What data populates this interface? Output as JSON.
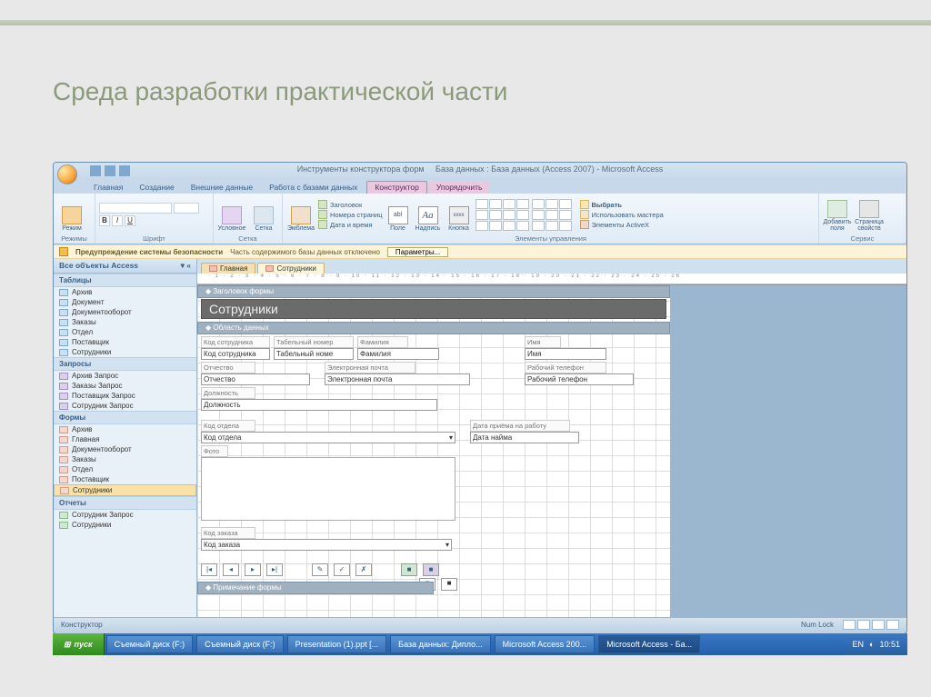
{
  "slide": {
    "title": "Среда разработки практической части"
  },
  "window": {
    "title_left": "Инструменты конструктора форм",
    "title_right": "База данных : База данных (Access 2007) - Microsoft Access"
  },
  "ribbon_tabs": [
    "Главная",
    "Создание",
    "Внешние данные",
    "Работа с базами данных",
    "Конструктор",
    "Упорядочить"
  ],
  "ribbon": {
    "g1": {
      "label": "Режимы",
      "btn": "Режим"
    },
    "g2": {
      "label": "Шрифт"
    },
    "g3": {
      "label": "Сетка",
      "btn1": "Условное",
      "btn2": "Сетка"
    },
    "g4": {
      "label": "Элементы управления",
      "btn_emblem": "Эмблема",
      "lines": [
        "Заголовок",
        "Номера страниц",
        "Дата и время"
      ],
      "btn_pole": "Поле",
      "btn_nadpis": "Надпись",
      "btn_knopka": "Кнопка",
      "side": [
        "Выбрать",
        "Использовать мастера",
        "Элементы ActiveX"
      ]
    },
    "g5": {
      "label": "Сервис",
      "btn_add": "Добавить поля",
      "btn_prop": "Страница свойств"
    }
  },
  "security": {
    "warn": "Предупреждение системы безопасности",
    "msg": "Часть содержимого базы данных отключено",
    "btn": "Параметры..."
  },
  "nav": {
    "header": "Все объекты Access",
    "sec": [
      "Таблицы",
      "Запросы",
      "Формы",
      "Отчеты"
    ],
    "tables": [
      "Архив",
      "Документ",
      "Документооборот",
      "Заказы",
      "Отдел",
      "Поставщик",
      "Сотрудники"
    ],
    "queries": [
      "Архив Запрос",
      "Заказы Запрос",
      "Поставщик Запрос",
      "Сотрудник Запрос"
    ],
    "forms": [
      "Архив",
      "Главная",
      "Документооборот",
      "Заказы",
      "Отдел",
      "Поставщик",
      "Сотрудники"
    ],
    "reports": [
      "Сотрудник Запрос",
      "Сотрудники"
    ]
  },
  "doc_tabs": [
    "Главная",
    "Сотрудники"
  ],
  "form": {
    "sec_header": "Заголовок формы",
    "title": "Сотрудники",
    "sec_data": "Область данных",
    "sec_footer": "Примечание формы",
    "labels": {
      "l1": "Код сотрудника",
      "l2": "Табельный номер",
      "l3": "Фамилия",
      "l4": "Имя",
      "l5": "Отчество",
      "l6": "Электронная почта",
      "l7": "Рабочий телефон",
      "l8": "Должность",
      "l9": "Код отдела",
      "l10": "Дата приёма на работу",
      "l11": "Фото",
      "l12": "Код заказа"
    },
    "fields": {
      "f1": "Код сотрудника",
      "f2": "Табельный номе",
      "f3": "Фамилия",
      "f4": "Имя",
      "f5": "Отчество",
      "f6": "Электронная почта",
      "f7": "Рабочий телефон",
      "f8": "Должность",
      "f9": "Код отдела",
      "f10": "Дата найма",
      "f12": "Код заказа"
    }
  },
  "status": {
    "mode": "Конструктор",
    "lock": "Num Lock"
  },
  "taskbar": {
    "start": "пуск",
    "items": [
      "Съемный диск (F:)",
      "Съемный диск (F:)",
      "Presentation (1).ppt [...",
      "База данных: Дипло...",
      "Microsoft Access 200...",
      "Microsoft Access - Ба..."
    ],
    "lang": "EN",
    "time": "10:51"
  }
}
